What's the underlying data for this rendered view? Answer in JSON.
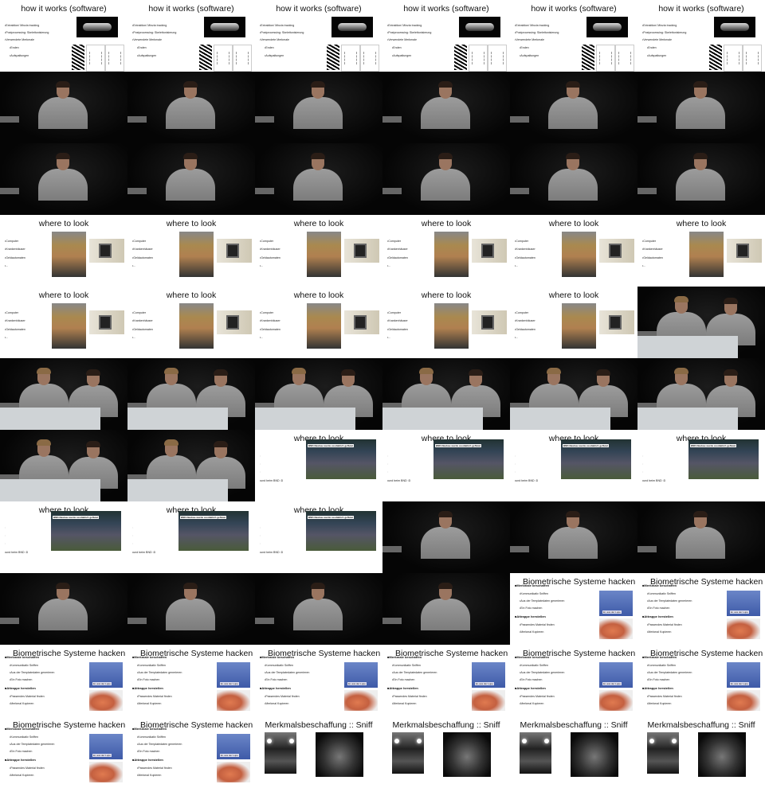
{
  "frames": [
    {
      "type": "software",
      "title": "how it works (software)",
      "bullets": [
        "Extraktion/ Minzia tracking",
        "Postprocessing: Skelettonisierung",
        "Verwendete Merkmale",
        "Enden",
        "Aufspaltungen"
      ]
    },
    {
      "type": "software",
      "title": "how it works (software)",
      "bullets": [
        "Extraktion/ Minzia tracking",
        "Postprocessing: Skelettonisierung",
        "Verwendete Merkmale",
        "Enden",
        "Aufspaltungen"
      ]
    },
    {
      "type": "software",
      "title": "how it works (software)",
      "bullets": [
        "Extraktion/ Minzia tracking",
        "Postprocessing: Skelettonisierung",
        "Verwendete Merkmale",
        "Enden",
        "Aufspaltungen"
      ]
    },
    {
      "type": "software",
      "title": "how it works (software)",
      "bullets": [
        "Extraktion/ Minzia tracking",
        "Postprocessing: Skelettonisierung",
        "Verwendete Merkmale",
        "Enden",
        "Aufspaltungen"
      ]
    },
    {
      "type": "software",
      "title": "how it works (software)",
      "bullets": [
        "Extraktion/ Minzia tracking",
        "Postprocessing: Skelettonisierung",
        "Verwendete Merkmale",
        "Enden",
        "Aufspaltungen"
      ]
    },
    {
      "type": "software",
      "title": "how it works (software)",
      "bullets": [
        "Extraktion/ Minzia tracking",
        "Postprocessing: Skelettonisierung",
        "Verwendete Merkmale",
        "Enden",
        "Aufspaltungen"
      ]
    },
    {
      "type": "video1"
    },
    {
      "type": "video1"
    },
    {
      "type": "video1"
    },
    {
      "type": "video1"
    },
    {
      "type": "video1"
    },
    {
      "type": "video1"
    },
    {
      "type": "video1"
    },
    {
      "type": "video1"
    },
    {
      "type": "video1"
    },
    {
      "type": "video1"
    },
    {
      "type": "video1"
    },
    {
      "type": "video1"
    },
    {
      "type": "look",
      "title": "where to look",
      "bullets": [
        "Computer",
        "Krankenhäuser",
        "Geldautomaten",
        "..."
      ]
    },
    {
      "type": "look",
      "title": "where to look",
      "bullets": [
        "Computer",
        "Krankenhäuser",
        "Geldautomaten",
        "..."
      ]
    },
    {
      "type": "look",
      "title": "where to look",
      "bullets": [
        "Computer",
        "Krankenhäuser",
        "Geldautomaten",
        "..."
      ]
    },
    {
      "type": "look",
      "title": "where to look",
      "bullets": [
        "Computer",
        "Krankenhäuser",
        "Geldautomaten",
        "..."
      ]
    },
    {
      "type": "look",
      "title": "where to look",
      "bullets": [
        "Computer",
        "Krankenhäuser",
        "Geldautomaten",
        "..."
      ]
    },
    {
      "type": "look",
      "title": "where to look",
      "bullets": [
        "Computer",
        "Krankenhäuser",
        "Geldautomaten",
        "..."
      ]
    },
    {
      "type": "look",
      "title": "where to look",
      "bullets": [
        "Computer",
        "Krankenhäuser",
        "Geldautomaten",
        "..."
      ]
    },
    {
      "type": "look",
      "title": "where to look",
      "bullets": [
        "Computer",
        "Krankenhäuser",
        "Geldautomaten",
        "..."
      ]
    },
    {
      "type": "look",
      "title": "where to look",
      "bullets": [
        "Computer",
        "Krankenhäuser",
        "Geldautomaten",
        "..."
      ]
    },
    {
      "type": "look",
      "title": "where to look",
      "bullets": [
        "Computer",
        "Krankenhäuser",
        "Geldautomaten",
        "..."
      ]
    },
    {
      "type": "look",
      "title": "where to look",
      "bullets": [
        "Computer",
        "Krankenhäuser",
        "Geldautomaten",
        "..."
      ]
    },
    {
      "type": "video2"
    },
    {
      "type": "video2"
    },
    {
      "type": "video2"
    },
    {
      "type": "video2"
    },
    {
      "type": "video2"
    },
    {
      "type": "video2"
    },
    {
      "type": "video2"
    },
    {
      "type": "video2"
    },
    {
      "type": "video2"
    },
    {
      "type": "bnd",
      "title": "where to look",
      "headline": "BND-Neubau wurde zeodaktich geflutet",
      "bullets": [
        "und beim BND :D"
      ]
    },
    {
      "type": "bnd",
      "title": "where to look",
      "headline": "BND-Neubau wurde zeodaktich geflutet",
      "bullets": [
        "und beim BND :D"
      ]
    },
    {
      "type": "bnd",
      "title": "where to look",
      "headline": "BND-Neubau wurde zeodaktich geflutet",
      "bullets": [
        "und beim BND :D"
      ]
    },
    {
      "type": "bnd",
      "title": "where to look",
      "headline": "BND-Neubau wurde zeodaktich geflutet",
      "bullets": [
        "und beim BND :D"
      ]
    },
    {
      "type": "bnd",
      "title": "where to look",
      "headline": "BND-Neubau wurde zeodaktich geflutet",
      "bullets": [
        "und beim BND :D"
      ]
    },
    {
      "type": "bnd",
      "title": "where to look",
      "headline": "BND-Neubau wurde zeodaktich geflutet",
      "bullets": [
        "und beim BND :D"
      ]
    },
    {
      "type": "bnd",
      "title": "where to look",
      "headline": "BND-Neubau wurde zeodaktich geflutet",
      "bullets": [
        "und beim BND :D"
      ]
    },
    {
      "type": "video1"
    },
    {
      "type": "video1"
    },
    {
      "type": "video1"
    },
    {
      "type": "video1"
    },
    {
      "type": "video1"
    },
    {
      "type": "video1"
    },
    {
      "type": "video1"
    },
    {
      "type": "bio",
      "title": "Biometrische Systeme hacken"
    },
    {
      "type": "bio",
      "title": "Biometrische Systeme hacken"
    },
    {
      "type": "bio",
      "title": "Biometrische Systeme hacken"
    },
    {
      "type": "bio",
      "title": "Biometrische Systeme hacken"
    },
    {
      "type": "bio",
      "title": "Biometrische Systeme hacken"
    },
    {
      "type": "bio",
      "title": "Biometrische Systeme hacken"
    },
    {
      "type": "bio",
      "title": "Biometrische Systeme hacken"
    },
    {
      "type": "bio",
      "title": "Biometrische Systeme hacken"
    },
    {
      "type": "bio",
      "title": "Biometrische Systeme hacken"
    },
    {
      "type": "bio",
      "title": "Biometrische Systeme hacken"
    },
    {
      "type": "sniff",
      "title": "Merkmalsbeschaffung :: Sniff"
    },
    {
      "type": "sniff",
      "title": "Merkmalsbeschaffung :: Sniff"
    },
    {
      "type": "sniff",
      "title": "Merkmalsbeschaffung :: Sniff"
    },
    {
      "type": "sniff",
      "title": "Merkmalsbeschaffung :: Sniff"
    }
  ],
  "bio_content": {
    "head1": "Merkmale beschaffen",
    "items1": [
      "Kommunikativ Sniffen",
      "Aus der Templatedaten generieren",
      "Ein Foto machen"
    ],
    "head2": "Attrappe herstellen",
    "items2": [
      "Passendes Material finden",
      "Merkmal Kopieren"
    ],
    "photo_label": "Ei, aus der Lupe"
  }
}
